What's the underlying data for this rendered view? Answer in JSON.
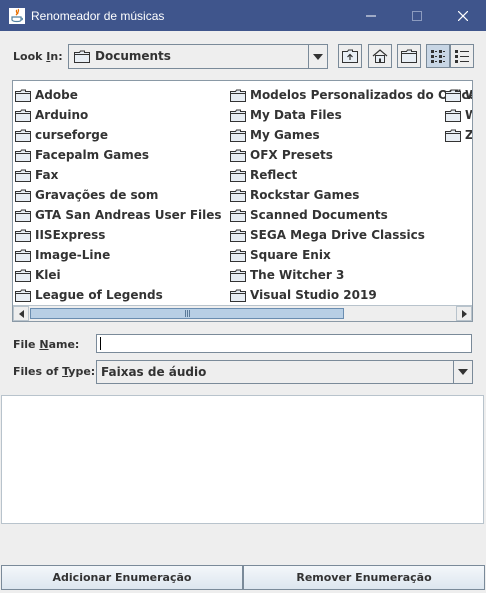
{
  "window": {
    "title": "Renomeador de músicas"
  },
  "look_in": {
    "label_prefix": "Look ",
    "label_mnemonic": "I",
    "label_suffix": "n:",
    "selected": "Documents"
  },
  "toolbar": {
    "buttons": [
      "up-one-level",
      "home",
      "new-folder",
      "list-view",
      "details-view"
    ],
    "active": "list-view"
  },
  "files": {
    "col1": [
      "Adobe",
      "Arduino",
      "curseforge",
      "Facepalm Games",
      "Fax",
      "Gravações de som",
      "GTA San Andreas User Files",
      "IISExpress",
      "Image-Line",
      "Klei",
      "League of Legends"
    ],
    "col2": [
      "Modelos Personalizados do Office",
      "My Data Files",
      "My Games",
      "OFX Presets",
      "Reflect",
      "Rockstar Games",
      "Scanned Documents",
      "SEGA Mega Drive Classics",
      "Square Enix",
      "The Witcher 3",
      "Visual Studio 2019"
    ],
    "col3": [
      "W",
      "W",
      "Z"
    ]
  },
  "file_name": {
    "label_prefix": "File ",
    "label_mnemonic": "N",
    "label_suffix": "ame:",
    "value": ""
  },
  "files_of_type": {
    "label_prefix": "Files of ",
    "label_mnemonic": "T",
    "label_suffix": "ype:",
    "selected": "Faixas de áudio"
  },
  "buttons": {
    "add_label": "Adicionar Enumeração",
    "remove_label": "Remover Enumeração"
  },
  "colors": {
    "titlebar": "#3f558c",
    "background": "#eeeeee",
    "list_background": "#ffffff",
    "folder": "#e8eef4"
  }
}
